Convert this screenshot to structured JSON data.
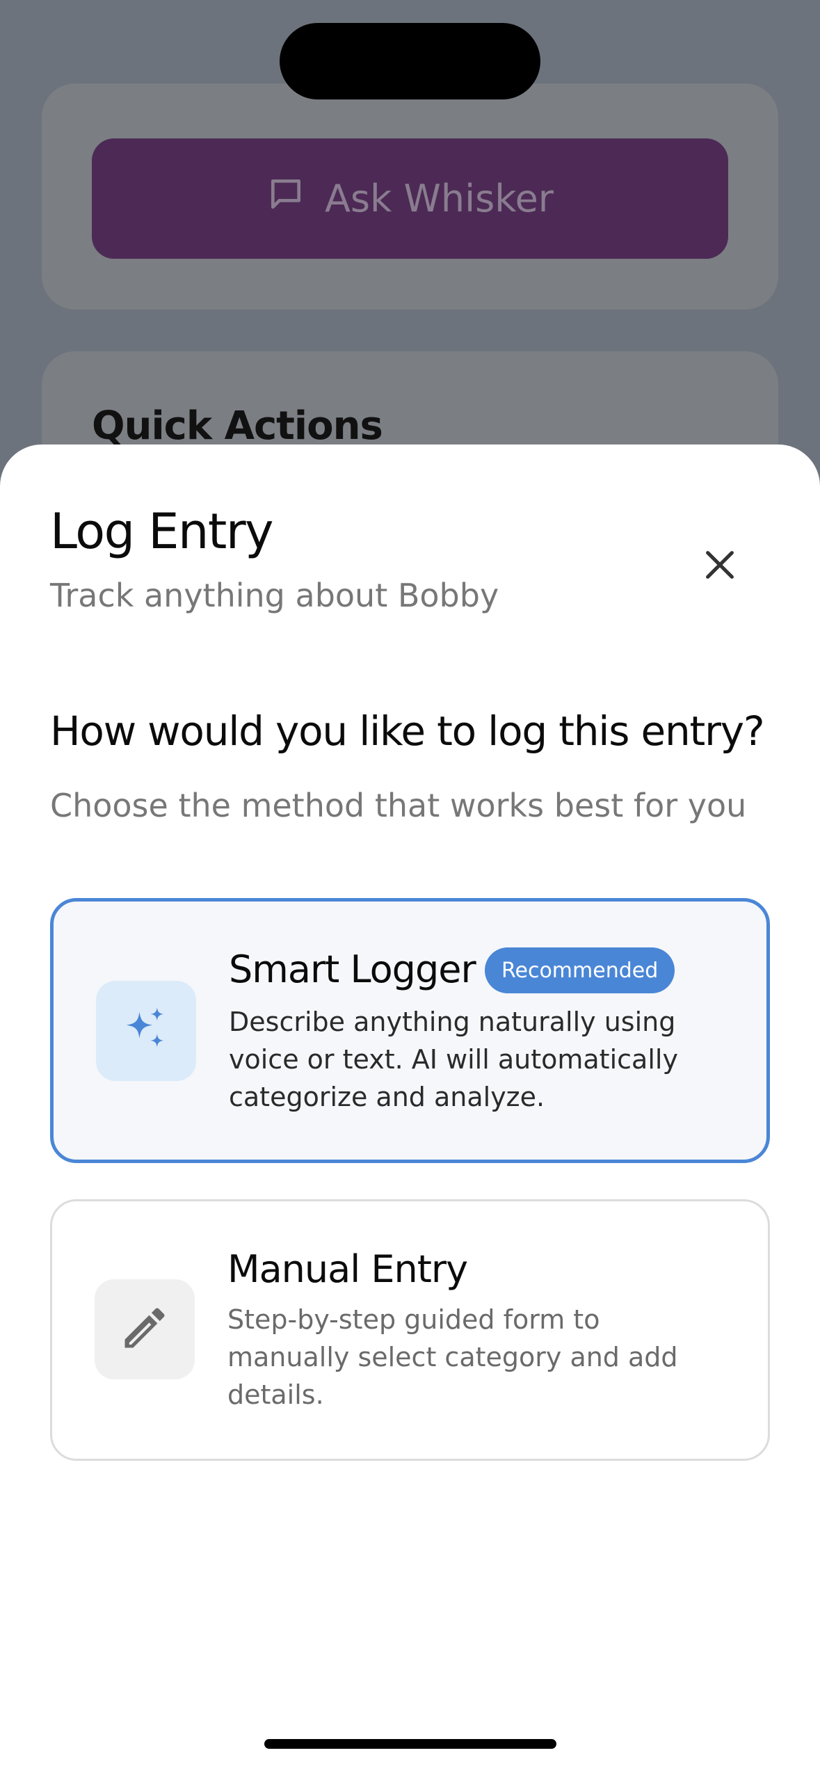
{
  "background": {
    "ask_button_label": "Ask Whisker",
    "quick_actions_title": "Quick Actions"
  },
  "sheet": {
    "title": "Log Entry",
    "subtitle": "Track anything about Bobby",
    "question": "How would you like to log this entry?",
    "hint": "Choose the method that works best for you",
    "options": [
      {
        "title": "Smart Logger",
        "badge": "Recommended",
        "description": "Describe anything naturally using voice or text. AI will automatically categorize and analyze.",
        "icon": "sparkles-icon",
        "selected": true
      },
      {
        "title": "Manual Entry",
        "description": "Step-by-step guided form to manually select category and add details.",
        "icon": "pencil-icon",
        "selected": false
      }
    ]
  },
  "colors": {
    "accent": "#4a86d6",
    "ask_button": "#4c2a55",
    "overlay": "#6c737c"
  }
}
